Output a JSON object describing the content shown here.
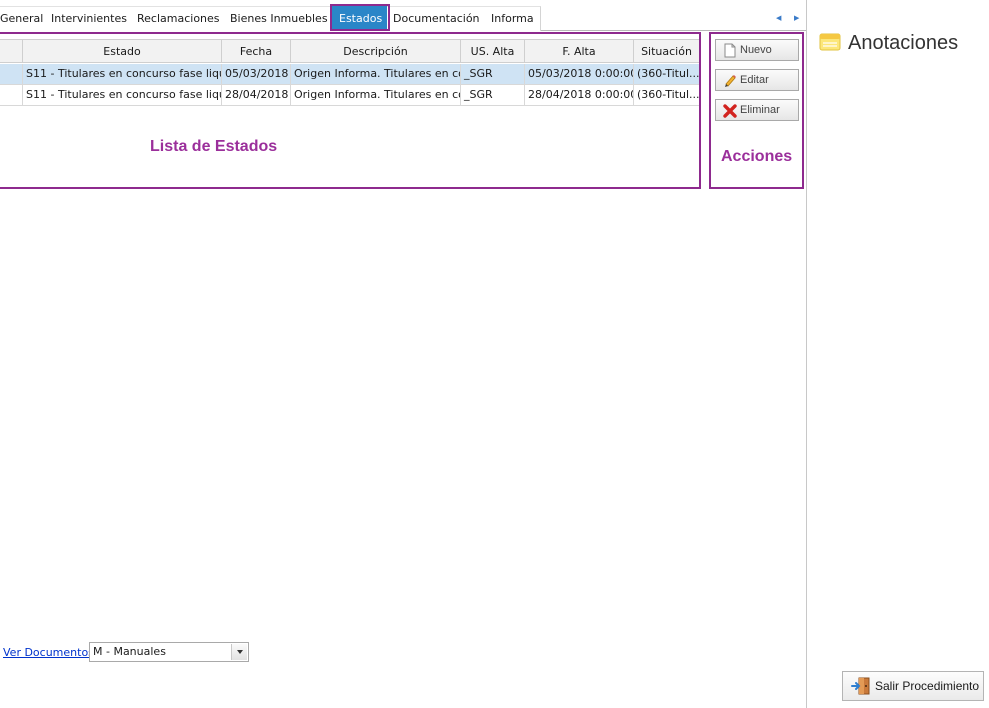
{
  "tabs": [
    {
      "label": "General",
      "active": false
    },
    {
      "label": "Intervinientes",
      "active": false
    },
    {
      "label": "Reclamaciones",
      "active": false
    },
    {
      "label": "Bienes Inmuebles",
      "active": false
    },
    {
      "label": "Estados",
      "active": true
    },
    {
      "label": "Documentación",
      "active": false
    },
    {
      "label": "Informa",
      "active": false
    }
  ],
  "grid": {
    "columns": [
      "Estado",
      "Fecha",
      "Descripción",
      "US. Alta",
      "F. Alta",
      "Situación"
    ],
    "rows": [
      {
        "estado": "S11 - Titulares en concurso fase liqui...",
        "fecha": "05/03/2018",
        "descripcion": "Origen Informa. Titulares en co...",
        "us_alta": "_SGR",
        "f_alta": "05/03/2018 0:00:00",
        "situacion": "(360-Titul...",
        "selected": true
      },
      {
        "estado": "S11 - Titulares en concurso fase liqui...",
        "fecha": "28/04/2018",
        "descripcion": "Origen Informa. Titulares en co...",
        "us_alta": "_SGR",
        "f_alta": "28/04/2018 0:00:00",
        "situacion": "(360-Titul...",
        "selected": false
      }
    ]
  },
  "annotations": {
    "list_label": "Lista de Estados",
    "actions_label": "Acciones",
    "color": "#8e2a8e"
  },
  "actions": {
    "new_label": "Nuevo",
    "edit_label": "Editar",
    "delete_label": "Eliminar"
  },
  "notes_panel": {
    "title": "Anotaciones"
  },
  "footer": {
    "docs_link": "Ver Documentos",
    "docs_select_value": "M - Manuales",
    "exit_label": "Salir Procedimiento"
  },
  "colors": {
    "active_tab": "#2a86c8",
    "selected_row": "#cfe3f4",
    "link": "#0033cc"
  }
}
